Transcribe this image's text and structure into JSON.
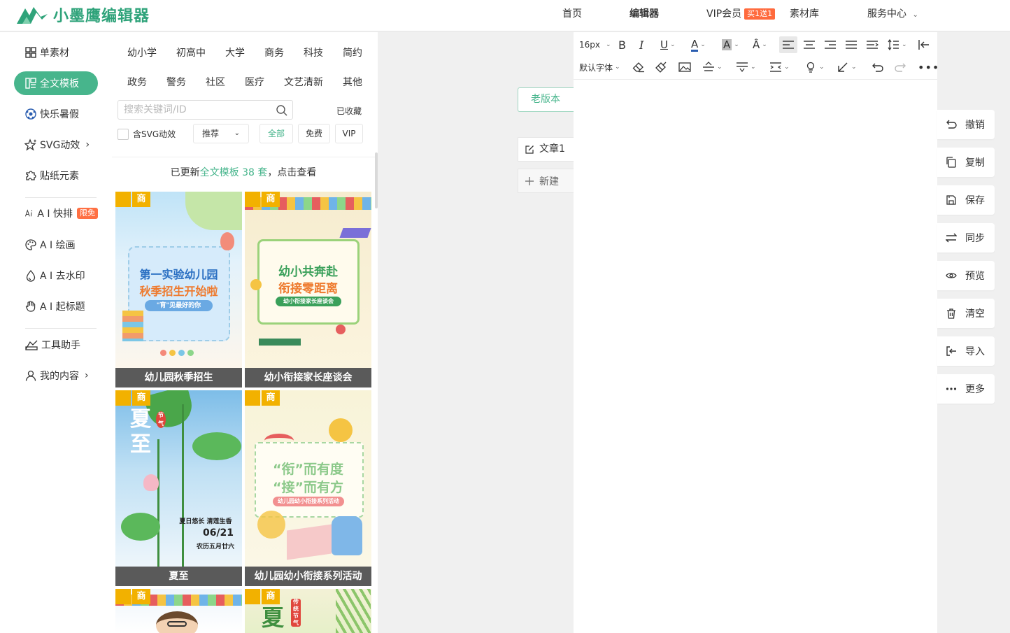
{
  "app": {
    "logo_text": "小墨鹰编辑器",
    "nav": [
      {
        "label": "首页"
      },
      {
        "label": "编辑器"
      },
      {
        "label": "VIP会员",
        "badge": "买1送1"
      },
      {
        "label": "素材库"
      },
      {
        "label": "服务中心"
      }
    ],
    "brand_color": "#47b58c"
  },
  "sidebar": {
    "items": [
      {
        "label": "单素材",
        "icon": "grid-icon"
      },
      {
        "label": "全文模板",
        "icon": "template-icon",
        "active": true
      },
      {
        "label": "快乐暑假",
        "icon": "football-icon"
      },
      {
        "label": "SVG动效",
        "icon": "sparkle-star-icon"
      },
      {
        "label": "贴纸元素",
        "icon": "puzzle-icon"
      },
      {
        "label": "A I 快排",
        "icon": "ai-icon",
        "badge": "限免"
      },
      {
        "label": "A I 绘画",
        "icon": "palette-icon"
      },
      {
        "label": "A I 去水印",
        "icon": "droplet-icon"
      },
      {
        "label": "A I 起标题",
        "icon": "hand-icon"
      },
      {
        "label": "工具助手",
        "icon": "tools-icon"
      },
      {
        "label": "我的内容",
        "icon": "user-icon"
      }
    ]
  },
  "templates": {
    "categories_row1": [
      "幼小学",
      "初高中",
      "大学",
      "商务",
      "科技",
      "简约"
    ],
    "categories_row2": [
      "政务",
      "警务",
      "社区",
      "医疗",
      "文艺清新",
      "其他"
    ],
    "search_placeholder": "搜索关键词/ID",
    "favorites_label": "已收藏",
    "svg_checkbox_label": "含SVG动效",
    "sort_label": "推荐",
    "filters": [
      "全部",
      "免费",
      "VIP"
    ],
    "notice": {
      "prefix": "已更新",
      "highlight": "全文模板 38 套",
      "suffix": "，点击查看"
    },
    "badge_label": "商",
    "cards": [
      {
        "caption": "幼儿园秋季招生",
        "title1": "第一实验幼儿园",
        "title2": "秋季招生开始啦",
        "tag": "\"育\"见最好的你"
      },
      {
        "caption": "幼小衔接家长座谈会",
        "title1": "幼小共奔赴",
        "title2": "衔接零距离",
        "tag": "幼小衔接家长座谈会"
      },
      {
        "caption": "夏至",
        "title1": "夏至",
        "small_tag": "节气",
        "line1": "夏日悠长 清莲生香",
        "date": "06/21",
        "line2": "农历五月廿六"
      },
      {
        "caption": "幼儿园幼小衔接系列活动",
        "title1": "“衔”而有度",
        "title2": "“接”而有方",
        "tag": "幼儿园幼小衔接系列活动"
      },
      {
        "caption": "",
        "title1": ""
      },
      {
        "caption": "",
        "title1": "夏",
        "small_tag": "传统节气"
      }
    ]
  },
  "docs": {
    "old_version": "老版本",
    "doc_name": "文章1",
    "new_doc": "新建"
  },
  "editor": {
    "font_size": "16px",
    "font_family": "默认字体"
  },
  "actions": [
    {
      "label": "撤销",
      "icon": "undo-icon"
    },
    {
      "label": "复制",
      "icon": "copy-icon"
    },
    {
      "label": "保存",
      "icon": "save-icon"
    },
    {
      "label": "同步",
      "icon": "sync-icon"
    },
    {
      "label": "预览",
      "icon": "eye-icon"
    },
    {
      "label": "清空",
      "icon": "trash-icon"
    },
    {
      "label": "导入",
      "icon": "import-icon"
    },
    {
      "label": "更多",
      "icon": "more-icon"
    }
  ]
}
